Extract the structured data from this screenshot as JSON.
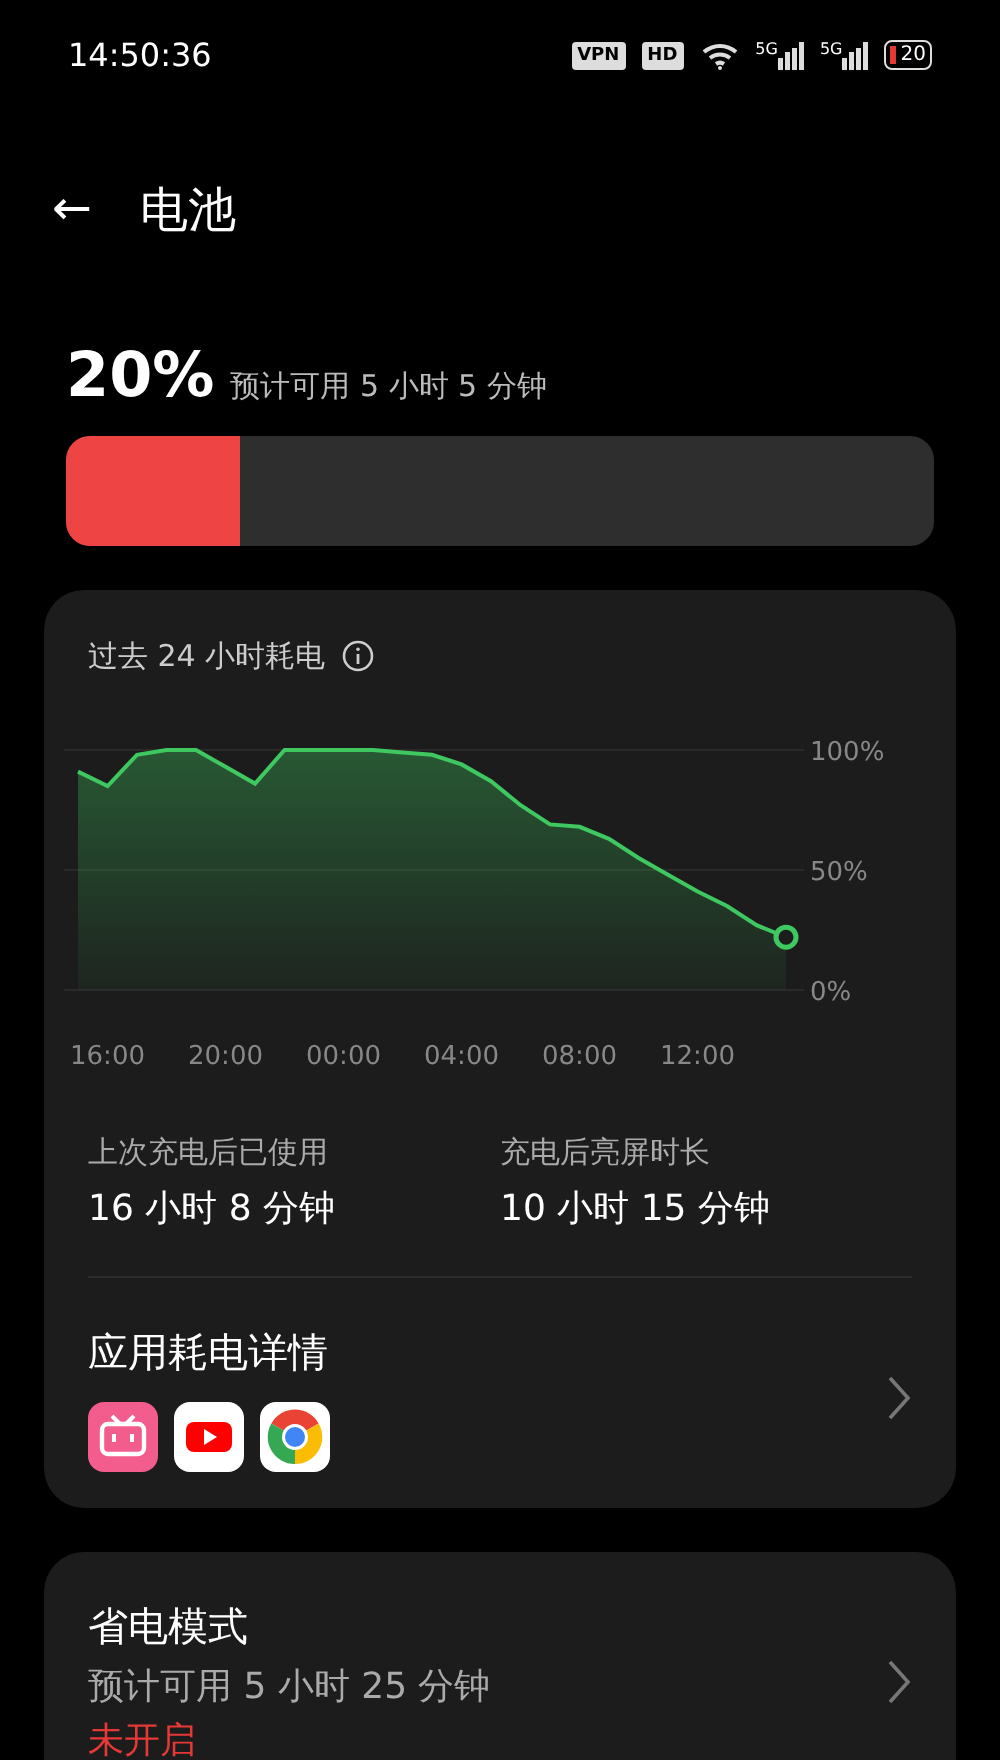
{
  "status_bar": {
    "time": "14:50:36",
    "vpn": "VPN",
    "hd": "HD",
    "networks": [
      "5G",
      "5G"
    ],
    "battery": "20"
  },
  "header": {
    "back": "←",
    "title": "电池"
  },
  "battery": {
    "percent": "20%",
    "estimate": "预计可用 5 小时 5 分钟",
    "level": 0.2
  },
  "usage_card": {
    "title": "过去 24 小时耗电",
    "chart_data": {
      "type": "area",
      "categories": [
        null,
        "16:00",
        null,
        null,
        null,
        "20:00",
        null,
        null,
        null,
        "00:00",
        null,
        null,
        null,
        "04:00",
        null,
        null,
        null,
        "08:00",
        null,
        null,
        null,
        "12:00",
        null,
        null,
        null
      ],
      "series": [
        {
          "color": "#3ec85f",
          "values": [
            91,
            85,
            98,
            100,
            100,
            93,
            86,
            100,
            100,
            100,
            100,
            99,
            98,
            94,
            87,
            77,
            69,
            68,
            63,
            55,
            48,
            41,
            35,
            27,
            22
          ]
        }
      ],
      "ylim": [
        0,
        100
      ],
      "yticks": [
        {
          "value": 100,
          "label": "100%"
        },
        {
          "value": 50,
          "label": "50%"
        },
        {
          "value": 0,
          "label": "0%"
        }
      ]
    },
    "stats": [
      {
        "label": "上次充电后已使用",
        "value": "16 小时 8 分钟"
      },
      {
        "label": "充电后亮屏时长",
        "value": "10 小时 15 分钟"
      }
    ],
    "apps_title": "应用耗电详情",
    "apps": [
      {
        "kind": "tv"
      },
      {
        "kind": "play"
      },
      {
        "kind": "ring"
      }
    ]
  },
  "saver_card": {
    "title": "省电模式",
    "subtitle": "预计可用 5 小时 25 分钟",
    "status": "未开启"
  }
}
